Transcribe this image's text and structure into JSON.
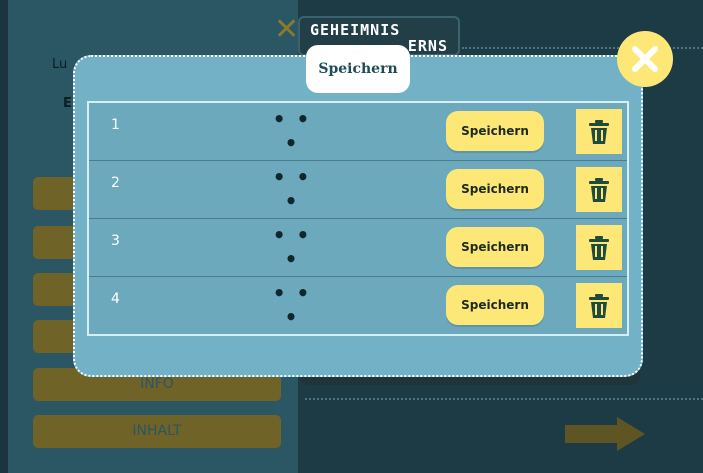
{
  "background": {
    "title_lines": [
      "GEHEIMNIS",
      "ERNS"
    ],
    "user_label": "Lu",
    "letter": "E",
    "menu_buttons": [
      "",
      "",
      "",
      "",
      "INFO",
      "INHALT"
    ]
  },
  "modal": {
    "title": "Speichern",
    "close_icon": "close-icon",
    "slots": [
      {
        "number": "1",
        "name": "• • •",
        "save_label": "Speichern"
      },
      {
        "number": "2",
        "name": "• • •",
        "save_label": "Speichern"
      },
      {
        "number": "3",
        "name": "• • •",
        "save_label": "Speichern"
      },
      {
        "number": "4",
        "name": "• • •",
        "save_label": "Speichern"
      }
    ]
  },
  "colors": {
    "modal_bg": "#73b2c6",
    "accent_yellow": "#fde877",
    "icon_dark": "#1f4b3c"
  }
}
